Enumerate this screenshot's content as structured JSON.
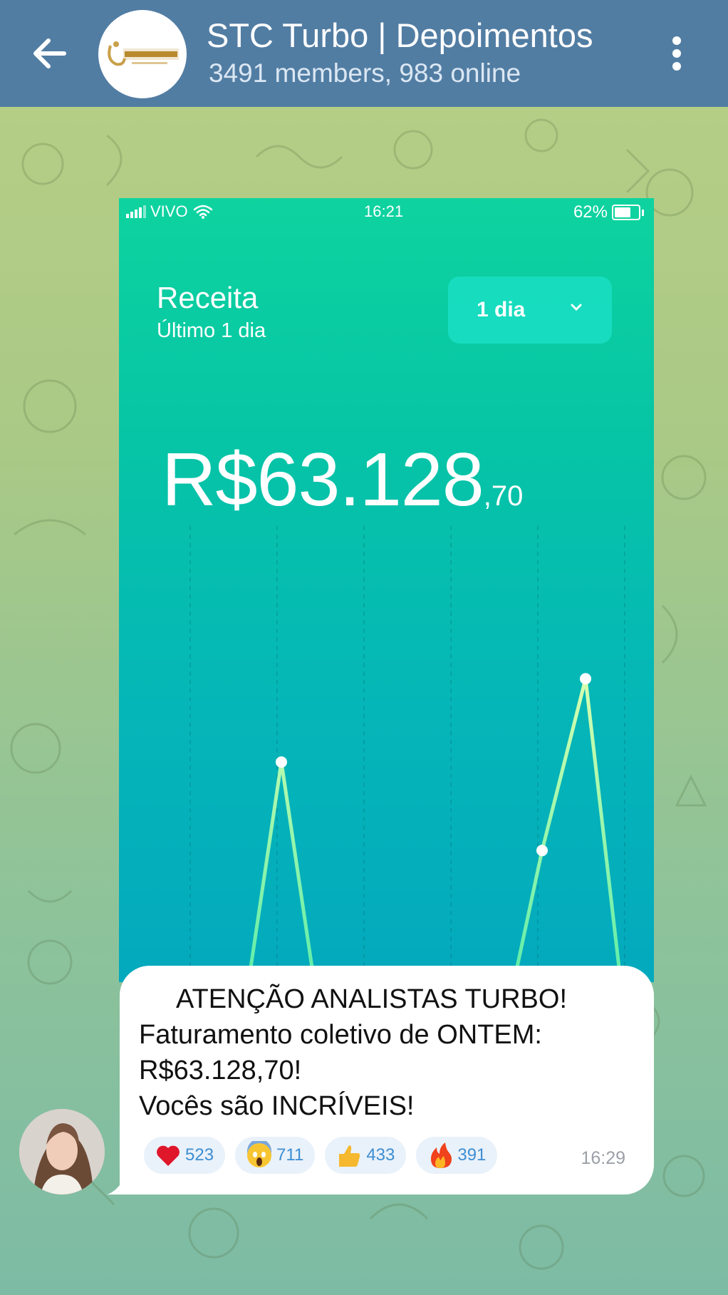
{
  "header": {
    "title": "STC Turbo | Depoimentos",
    "subtitle": "3491 members, 983 online",
    "avatar_logo_text": "SUPER TIKTOK",
    "avatar_logo_sub": "CASHTURBO",
    "back_icon": "arrow-left-icon",
    "menu_icon": "more-vertical-icon"
  },
  "photo": {
    "status_bar": {
      "carrier": "VIVO",
      "time": "16:21",
      "battery": "62%"
    },
    "card_title": "Receita",
    "card_subtitle": "Último 1 dia",
    "period_select": "1 dia",
    "amount_main": "R$63.128",
    "amount_cents": ",70"
  },
  "chart_data": {
    "type": "line",
    "title": "",
    "xlabel": "",
    "ylabel": "",
    "grid": true,
    "x": [
      0,
      1,
      2,
      3,
      4,
      5,
      6,
      7,
      8,
      9,
      10,
      11
    ],
    "series": [
      {
        "values": [
          0,
          0,
          0,
          0.56,
          0,
          0,
          0,
          0,
          0,
          0.39,
          0.72,
          0
        ]
      }
    ]
  },
  "message": {
    "lines": [
      "ATENÇÃO ANALISTAS TURBO!",
      "Faturamento coletivo de ONTEM:",
      "R$63.128,70!",
      "Vocês são INCRÍVEIS!"
    ],
    "reactions": [
      {
        "icon": "heart-icon",
        "count": "523"
      },
      {
        "icon": "scream-face-icon",
        "count": "711"
      },
      {
        "icon": "thumbs-up-icon",
        "count": "433"
      },
      {
        "icon": "fire-icon",
        "count": "391"
      }
    ],
    "time": "16:29"
  },
  "colors": {
    "header": "#527da3",
    "photo_top": "#0ed39f",
    "photo_bottom": "#03a9bd",
    "chart_line": "#3fe9a8",
    "reaction_text": "#3d8ed2"
  }
}
